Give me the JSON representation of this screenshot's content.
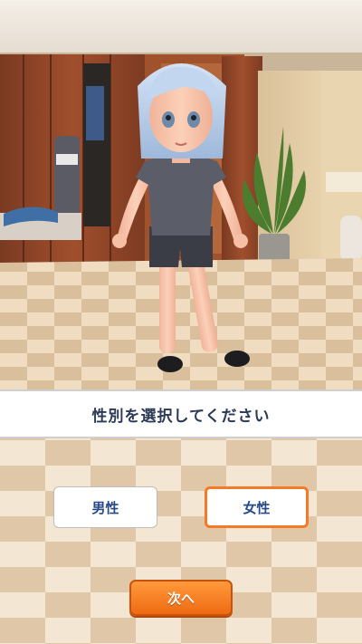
{
  "prompt": {
    "text": "性別を選択してください"
  },
  "gender": {
    "male_label": "男性",
    "female_label": "女性",
    "selected": "female"
  },
  "next_button": {
    "label": "次へ"
  },
  "colors": {
    "accent_orange": "#f47a2a",
    "label_blue": "#274a86",
    "prompt_text": "#2c3a55"
  }
}
